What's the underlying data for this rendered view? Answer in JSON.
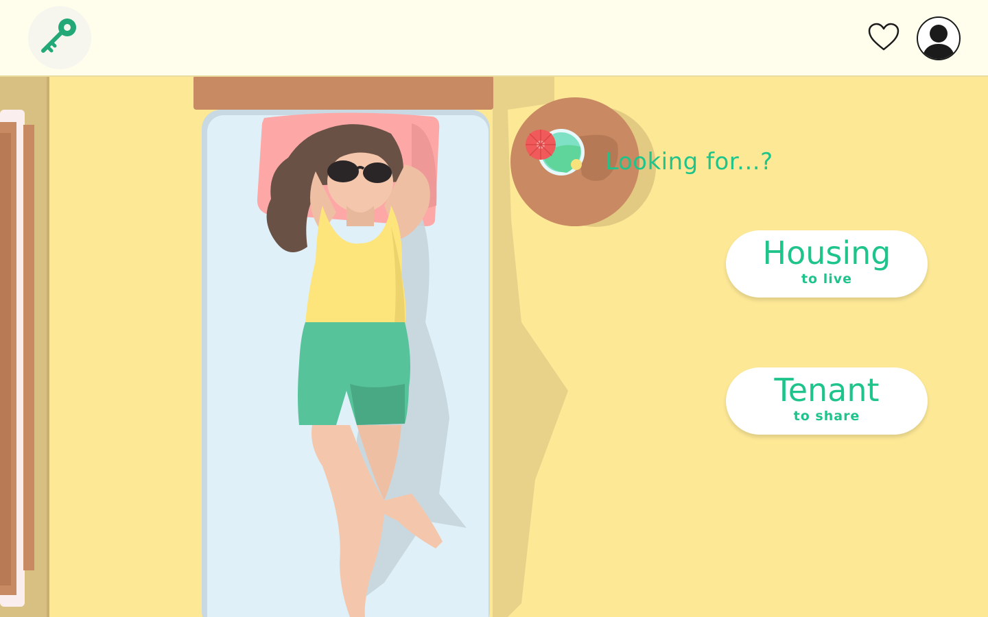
{
  "header": {
    "logo_icon": "key-icon",
    "favorites_icon": "heart-icon",
    "profile_icon": "user-avatar-icon"
  },
  "main": {
    "prompt": "Looking for...?",
    "options": [
      {
        "label": "Housing",
        "sublabel": "to live"
      },
      {
        "label": "Tenant",
        "sublabel": "to share"
      }
    ]
  },
  "colors": {
    "accent": "#1ec48a",
    "background": "#fde896",
    "header_bg": "#fffeec"
  }
}
